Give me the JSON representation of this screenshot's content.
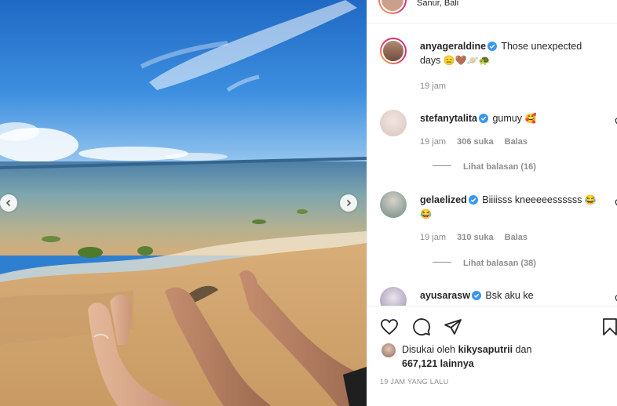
{
  "header": {
    "location": "Sanur, Bali"
  },
  "caption": {
    "username": "anyageraldine",
    "text": "Those unexpected days",
    "emoji": "😑🤎🪐🐢",
    "time": "19 jam"
  },
  "comments": [
    {
      "username": "stefanytalita",
      "text": "gumuy",
      "emoji": "🥰",
      "time": "19 jam",
      "likes": "306 suka",
      "reply_label": "Balas",
      "view_replies": "Lihat balasan (16)"
    },
    {
      "username": "gelaelized",
      "text": "Biiiisss kneeeeessssss",
      "emoji": "😂😂",
      "time": "19 jam",
      "likes": "310 suka",
      "reply_label": "Balas",
      "view_replies": "Lihat balasan (38)"
    },
    {
      "username": "ayusarasw",
      "text": "Bsk aku ke",
      "emoji": "",
      "time": "",
      "likes": "",
      "reply_label": "",
      "view_replies": ""
    }
  ],
  "liked_by": {
    "prefix": "Disukai oleh",
    "user": "kikysaputrii",
    "and": "dan",
    "others": "667,121 lainnya"
  },
  "timestamp": "19 JAM YANG LALU",
  "icons": {
    "like": "heart-icon",
    "comment": "comment-icon",
    "share": "share-icon",
    "save": "bookmark-icon",
    "prev": "chevron-left-icon",
    "next": "chevron-right-icon",
    "verified": "verified-badge-icon"
  },
  "colors": {
    "verified": "#3897f0",
    "muted": "#8e8e8e",
    "text": "#262626"
  }
}
